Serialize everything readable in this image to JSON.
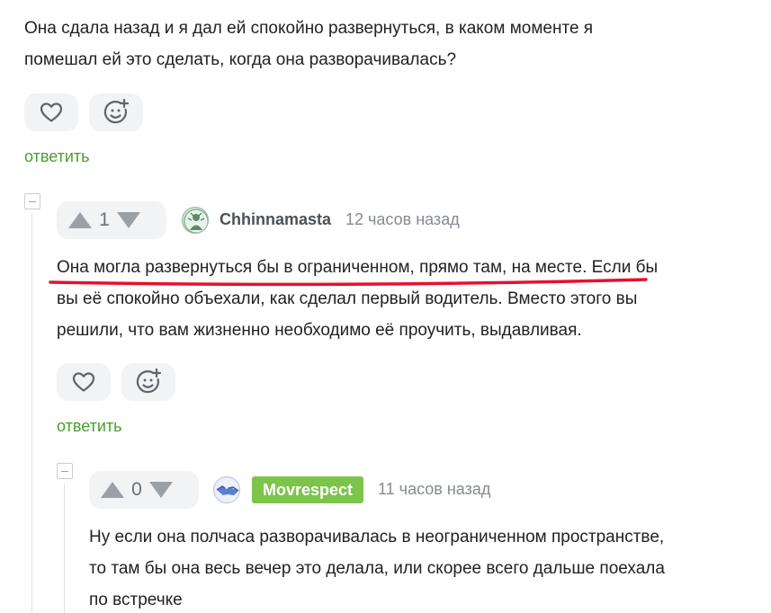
{
  "comment_top": {
    "text_line1": "Она сдала назад и я дал ей спокойно развернуться, в каком моменте я",
    "text_line2": "помешал ей это сделать, когда она разворачивалась?",
    "reply_label": "ответить"
  },
  "comment_1": {
    "rating": "1",
    "username": "Chhinnamasta",
    "time": "12 часов назад",
    "text_line1": "Она могла развернуться бы в ограниченном, прямо там, на месте. Если бы",
    "text_line2": "вы её спокойно объехали, как сделал первый водитель. Вместо этого вы",
    "text_line3": "решили, что вам жизненно необходимо её проучить, выдавливая.",
    "reply_label": "ответить",
    "underline_color": "#e8102c"
  },
  "comment_2": {
    "rating": "0",
    "username": "Movrespect",
    "time": "11 часов назад",
    "text_line1": "Ну если она полчаса разворачивалась в неограниченном пространстве,",
    "text_line2": "то там бы она весь вечер это делала, или скорее всего дальше поехала",
    "text_line3": "по встречке"
  },
  "icons": {
    "like": "heart-icon",
    "react": "smiley-plus-icon",
    "upvote": "triangle-up-icon",
    "downvote": "triangle-down-icon",
    "collapse": "collapse-minus-icon"
  },
  "colors": {
    "reply_link": "#4a9e2c",
    "user_badge": "#7cc44a",
    "button_bg": "#f2f3f5"
  }
}
